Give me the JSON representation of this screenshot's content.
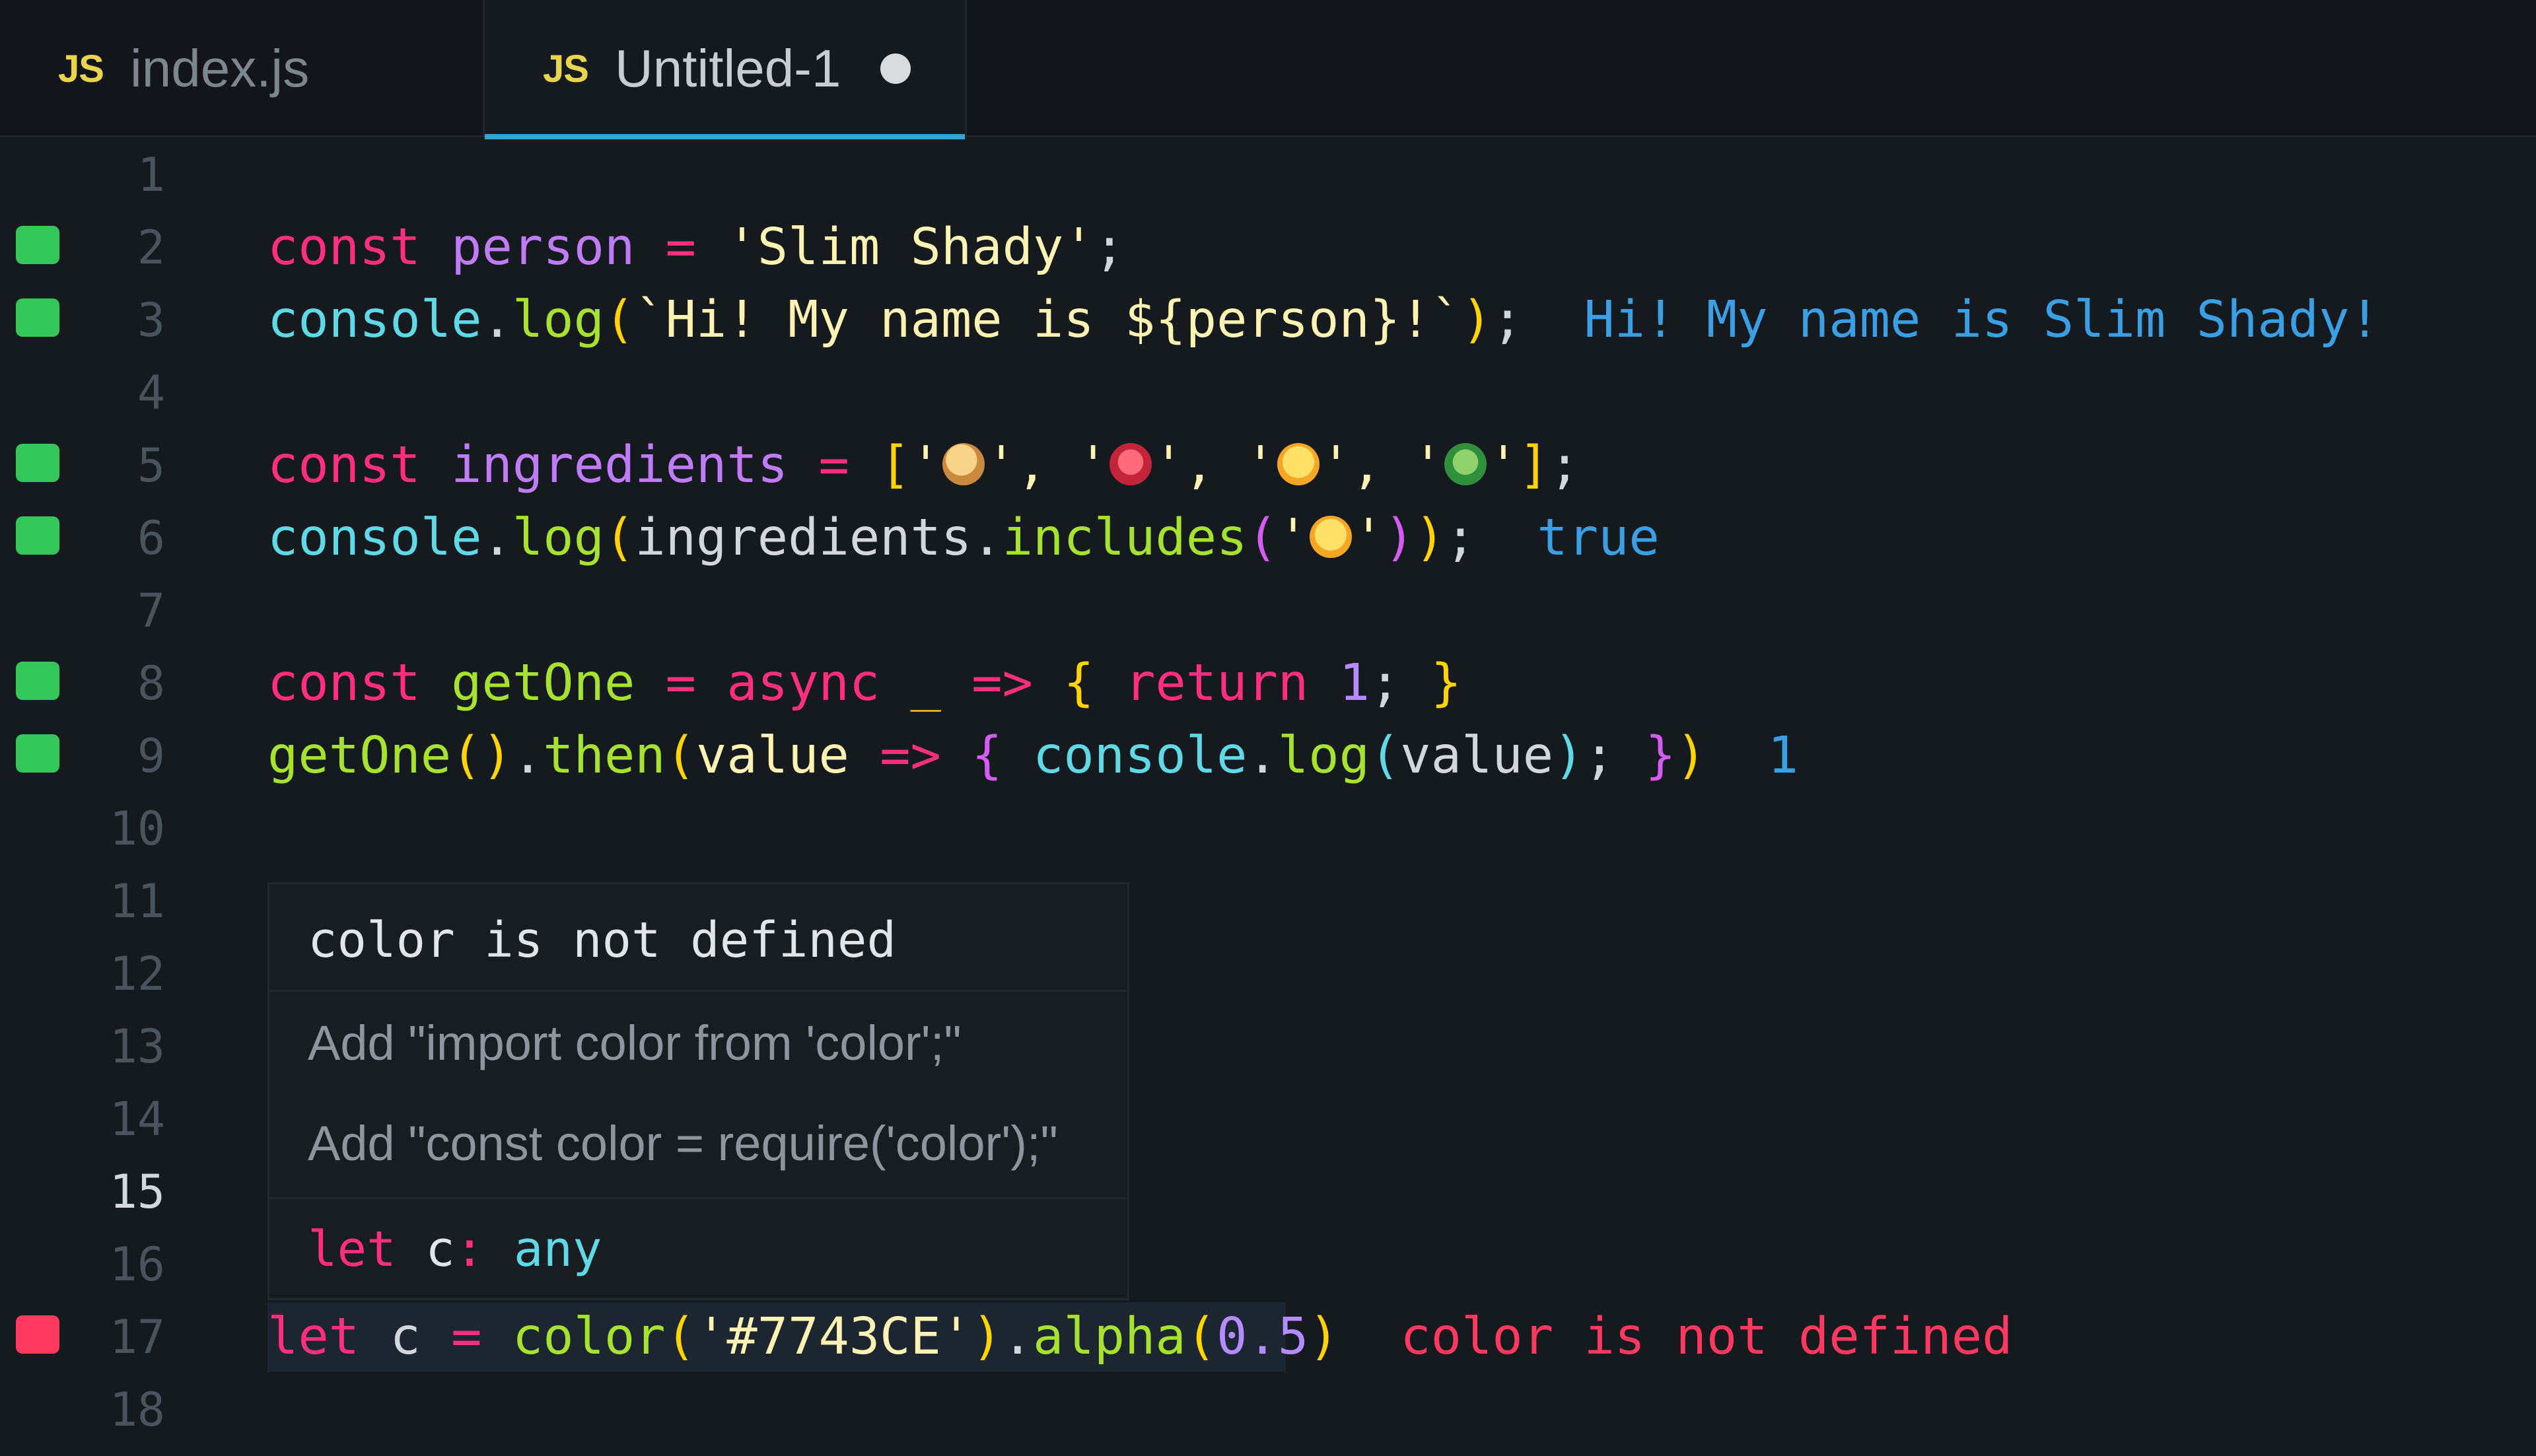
{
  "tabs": [
    {
      "badge": "JS",
      "label": "index.js",
      "active": false
    },
    {
      "badge": "JS",
      "label": "Untitled-1",
      "active": true,
      "unsaved": true
    }
  ],
  "gutter": {
    "line_numbers": [
      "1",
      "2",
      "3",
      "4",
      "5",
      "6",
      "7",
      "8",
      "9",
      "10",
      "11",
      "12",
      "13",
      "14",
      "15",
      "16",
      "17",
      "18"
    ],
    "active_line": "15"
  },
  "code": {
    "l2": {
      "const": "const",
      "name": "person",
      "eq": "=",
      "value": "'Slim Shady'",
      "semi": ";"
    },
    "l3": {
      "console": "console",
      "dot": ".",
      "log": "log",
      "open": "(",
      "tpl": "`Hi! My name is ${person}!`",
      "close": ")",
      "semi": ";",
      "output": "Hi! My name is Slim Shady!"
    },
    "l5": {
      "const": "const",
      "name": "ingredients",
      "eq": "=",
      "open": "[",
      "q1": "'",
      "sep": "', '",
      "q2": "'",
      "close": "]",
      "semi": ";",
      "emojis": [
        "bread-emoji",
        "meat-emoji",
        "cheese-emoji",
        "salad-emoji"
      ]
    },
    "l6": {
      "console": "console",
      "dot": ".",
      "log": "log",
      "open": "(",
      "arg": "ingredients",
      "dot2": ".",
      "includes": "includes",
      "open2": "(",
      "q": "'",
      "q_end": "'",
      "close2": ")",
      "close": ")",
      "semi": ";",
      "output": "true"
    },
    "l8": {
      "const": "const",
      "name": "getOne",
      "eq": "=",
      "async": "async",
      "underscore": "_",
      "arrow": "=>",
      "lbrace": "{",
      "ret": "return",
      "one": "1",
      "semi": ";",
      "rbrace": "}"
    },
    "l9": {
      "fn": "getOne",
      "call": "()",
      "dot": ".",
      "then": "then",
      "open": "(",
      "param": "value",
      "arrow": "=>",
      "lbrace": "{",
      "console": "console",
      "dot2": ".",
      "log": "log",
      "open2": "(",
      "arg": "value",
      "close2": ")",
      "semi": ";",
      "rbrace": "}",
      "close": ")",
      "output": "1"
    },
    "l17": {
      "let": "let",
      "name": "c",
      "eq": "=",
      "fn": "color",
      "open": "(",
      "str": "'#7743CE'",
      "close": ")",
      "dot": ".",
      "alpha": "alpha",
      "open2": "(",
      "num": "0.5",
      "close2": ")",
      "error": "color is not defined"
    }
  },
  "popup": {
    "title": "color is not defined",
    "actions": [
      "Add \"import color from 'color';\"",
      "Add \"const color = require('color');\""
    ],
    "signature": {
      "let": "let",
      "name": "c",
      "colon": ":",
      "type": "any"
    }
  },
  "colors": {
    "background": "#151a1e",
    "keyword": "#ff2e7e",
    "string": "#fff3b3",
    "function": "#5ed9e6",
    "method": "#a6e22e",
    "result": "#3aa0e6",
    "error": "#ff3860",
    "marker_ok": "#34c759",
    "tab_underline": "#2aa8d8"
  }
}
